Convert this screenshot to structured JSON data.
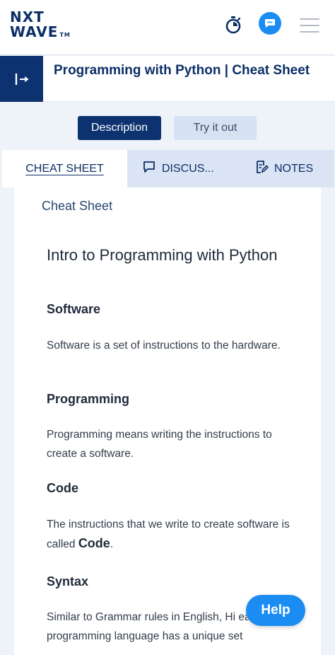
{
  "header": {
    "logo_line1": "NXT",
    "logo_line2": "WAVE",
    "logo_tm": "TM",
    "timer_icon": "stopwatch-icon",
    "chat_icon": "chat-bubble-icon",
    "menu_icon": "hamburger-menu-icon"
  },
  "titlebar": {
    "toggle_icon": "sidebar-expand-icon",
    "title": "Programming with Python | Cheat Sheet"
  },
  "mode_buttons": {
    "description": "Description",
    "try_it_out": "Try it out"
  },
  "tabs": [
    {
      "label": "CHEAT SHEET",
      "active": true
    },
    {
      "label": "DISCUS...",
      "icon": "message-square-icon"
    },
    {
      "label": "NOTES",
      "icon": "edit-note-icon"
    }
  ],
  "content": {
    "section_label": "Cheat Sheet",
    "title": "Intro to Programming with Python",
    "blocks": [
      {
        "heading": "Software",
        "text": "Software is a set of instructions to the hardware."
      },
      {
        "heading": "Programming",
        "text": "Programming means writing the instructions to create a software."
      },
      {
        "heading": "Code",
        "text_before": "The instructions that we write to create software is called ",
        "text_bold": "Code",
        "text_after": "."
      },
      {
        "heading": "Syntax",
        "text": "Similar to Grammar rules in English, Hi each programming language has a unique set"
      }
    ]
  },
  "help_button": "Help",
  "colors": {
    "brand_navy": "#0c3270",
    "accent_blue": "#1b8cf2",
    "tab_bg": "#dbe4f4"
  }
}
